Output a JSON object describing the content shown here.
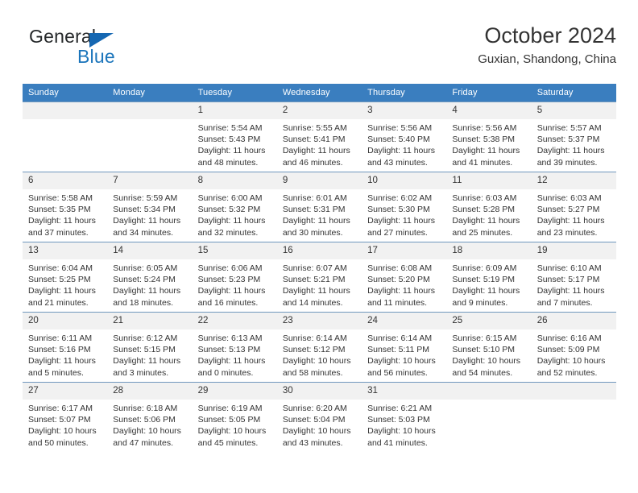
{
  "brand": {
    "name_primary": "General",
    "name_secondary": "Blue"
  },
  "header": {
    "title": "October 2024",
    "location": "Guxian, Shandong, China"
  },
  "colors": {
    "header_blue": "#3a7ebf",
    "brand_blue": "#1b75bb",
    "row_divider": "#6f97bd",
    "daynum_band": "#f1f1f1",
    "text": "#333333"
  },
  "weekdays": [
    "Sunday",
    "Monday",
    "Tuesday",
    "Wednesday",
    "Thursday",
    "Friday",
    "Saturday"
  ],
  "labels": {
    "sunrise_prefix": "Sunrise:",
    "sunset_prefix": "Sunset:",
    "daylight_prefix": "Daylight:"
  },
  "weeks": [
    [
      {
        "day": "",
        "sunrise": "",
        "sunset": "",
        "daylight_1": "",
        "daylight_2": ""
      },
      {
        "day": "",
        "sunrise": "",
        "sunset": "",
        "daylight_1": "",
        "daylight_2": ""
      },
      {
        "day": "1",
        "sunrise": "Sunrise: 5:54 AM",
        "sunset": "Sunset: 5:43 PM",
        "daylight_1": "Daylight: 11 hours",
        "daylight_2": "and 48 minutes."
      },
      {
        "day": "2",
        "sunrise": "Sunrise: 5:55 AM",
        "sunset": "Sunset: 5:41 PM",
        "daylight_1": "Daylight: 11 hours",
        "daylight_2": "and 46 minutes."
      },
      {
        "day": "3",
        "sunrise": "Sunrise: 5:56 AM",
        "sunset": "Sunset: 5:40 PM",
        "daylight_1": "Daylight: 11 hours",
        "daylight_2": "and 43 minutes."
      },
      {
        "day": "4",
        "sunrise": "Sunrise: 5:56 AM",
        "sunset": "Sunset: 5:38 PM",
        "daylight_1": "Daylight: 11 hours",
        "daylight_2": "and 41 minutes."
      },
      {
        "day": "5",
        "sunrise": "Sunrise: 5:57 AM",
        "sunset": "Sunset: 5:37 PM",
        "daylight_1": "Daylight: 11 hours",
        "daylight_2": "and 39 minutes."
      }
    ],
    [
      {
        "day": "6",
        "sunrise": "Sunrise: 5:58 AM",
        "sunset": "Sunset: 5:35 PM",
        "daylight_1": "Daylight: 11 hours",
        "daylight_2": "and 37 minutes."
      },
      {
        "day": "7",
        "sunrise": "Sunrise: 5:59 AM",
        "sunset": "Sunset: 5:34 PM",
        "daylight_1": "Daylight: 11 hours",
        "daylight_2": "and 34 minutes."
      },
      {
        "day": "8",
        "sunrise": "Sunrise: 6:00 AM",
        "sunset": "Sunset: 5:32 PM",
        "daylight_1": "Daylight: 11 hours",
        "daylight_2": "and 32 minutes."
      },
      {
        "day": "9",
        "sunrise": "Sunrise: 6:01 AM",
        "sunset": "Sunset: 5:31 PM",
        "daylight_1": "Daylight: 11 hours",
        "daylight_2": "and 30 minutes."
      },
      {
        "day": "10",
        "sunrise": "Sunrise: 6:02 AM",
        "sunset": "Sunset: 5:30 PM",
        "daylight_1": "Daylight: 11 hours",
        "daylight_2": "and 27 minutes."
      },
      {
        "day": "11",
        "sunrise": "Sunrise: 6:03 AM",
        "sunset": "Sunset: 5:28 PM",
        "daylight_1": "Daylight: 11 hours",
        "daylight_2": "and 25 minutes."
      },
      {
        "day": "12",
        "sunrise": "Sunrise: 6:03 AM",
        "sunset": "Sunset: 5:27 PM",
        "daylight_1": "Daylight: 11 hours",
        "daylight_2": "and 23 minutes."
      }
    ],
    [
      {
        "day": "13",
        "sunrise": "Sunrise: 6:04 AM",
        "sunset": "Sunset: 5:25 PM",
        "daylight_1": "Daylight: 11 hours",
        "daylight_2": "and 21 minutes."
      },
      {
        "day": "14",
        "sunrise": "Sunrise: 6:05 AM",
        "sunset": "Sunset: 5:24 PM",
        "daylight_1": "Daylight: 11 hours",
        "daylight_2": "and 18 minutes."
      },
      {
        "day": "15",
        "sunrise": "Sunrise: 6:06 AM",
        "sunset": "Sunset: 5:23 PM",
        "daylight_1": "Daylight: 11 hours",
        "daylight_2": "and 16 minutes."
      },
      {
        "day": "16",
        "sunrise": "Sunrise: 6:07 AM",
        "sunset": "Sunset: 5:21 PM",
        "daylight_1": "Daylight: 11 hours",
        "daylight_2": "and 14 minutes."
      },
      {
        "day": "17",
        "sunrise": "Sunrise: 6:08 AM",
        "sunset": "Sunset: 5:20 PM",
        "daylight_1": "Daylight: 11 hours",
        "daylight_2": "and 11 minutes."
      },
      {
        "day": "18",
        "sunrise": "Sunrise: 6:09 AM",
        "sunset": "Sunset: 5:19 PM",
        "daylight_1": "Daylight: 11 hours",
        "daylight_2": "and 9 minutes."
      },
      {
        "day": "19",
        "sunrise": "Sunrise: 6:10 AM",
        "sunset": "Sunset: 5:17 PM",
        "daylight_1": "Daylight: 11 hours",
        "daylight_2": "and 7 minutes."
      }
    ],
    [
      {
        "day": "20",
        "sunrise": "Sunrise: 6:11 AM",
        "sunset": "Sunset: 5:16 PM",
        "daylight_1": "Daylight: 11 hours",
        "daylight_2": "and 5 minutes."
      },
      {
        "day": "21",
        "sunrise": "Sunrise: 6:12 AM",
        "sunset": "Sunset: 5:15 PM",
        "daylight_1": "Daylight: 11 hours",
        "daylight_2": "and 3 minutes."
      },
      {
        "day": "22",
        "sunrise": "Sunrise: 6:13 AM",
        "sunset": "Sunset: 5:13 PM",
        "daylight_1": "Daylight: 11 hours",
        "daylight_2": "and 0 minutes."
      },
      {
        "day": "23",
        "sunrise": "Sunrise: 6:14 AM",
        "sunset": "Sunset: 5:12 PM",
        "daylight_1": "Daylight: 10 hours",
        "daylight_2": "and 58 minutes."
      },
      {
        "day": "24",
        "sunrise": "Sunrise: 6:14 AM",
        "sunset": "Sunset: 5:11 PM",
        "daylight_1": "Daylight: 10 hours",
        "daylight_2": "and 56 minutes."
      },
      {
        "day": "25",
        "sunrise": "Sunrise: 6:15 AM",
        "sunset": "Sunset: 5:10 PM",
        "daylight_1": "Daylight: 10 hours",
        "daylight_2": "and 54 minutes."
      },
      {
        "day": "26",
        "sunrise": "Sunrise: 6:16 AM",
        "sunset": "Sunset: 5:09 PM",
        "daylight_1": "Daylight: 10 hours",
        "daylight_2": "and 52 minutes."
      }
    ],
    [
      {
        "day": "27",
        "sunrise": "Sunrise: 6:17 AM",
        "sunset": "Sunset: 5:07 PM",
        "daylight_1": "Daylight: 10 hours",
        "daylight_2": "and 50 minutes."
      },
      {
        "day": "28",
        "sunrise": "Sunrise: 6:18 AM",
        "sunset": "Sunset: 5:06 PM",
        "daylight_1": "Daylight: 10 hours",
        "daylight_2": "and 47 minutes."
      },
      {
        "day": "29",
        "sunrise": "Sunrise: 6:19 AM",
        "sunset": "Sunset: 5:05 PM",
        "daylight_1": "Daylight: 10 hours",
        "daylight_2": "and 45 minutes."
      },
      {
        "day": "30",
        "sunrise": "Sunrise: 6:20 AM",
        "sunset": "Sunset: 5:04 PM",
        "daylight_1": "Daylight: 10 hours",
        "daylight_2": "and 43 minutes."
      },
      {
        "day": "31",
        "sunrise": "Sunrise: 6:21 AM",
        "sunset": "Sunset: 5:03 PM",
        "daylight_1": "Daylight: 10 hours",
        "daylight_2": "and 41 minutes."
      },
      {
        "day": "",
        "sunrise": "",
        "sunset": "",
        "daylight_1": "",
        "daylight_2": ""
      },
      {
        "day": "",
        "sunrise": "",
        "sunset": "",
        "daylight_1": "",
        "daylight_2": ""
      }
    ]
  ]
}
